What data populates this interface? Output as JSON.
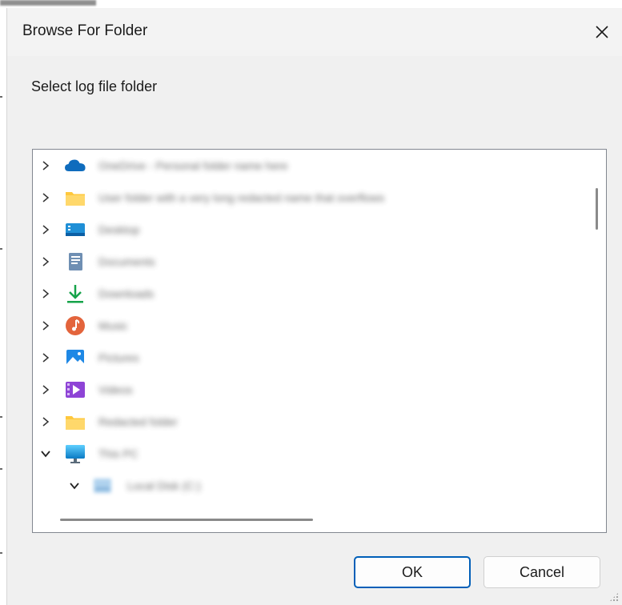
{
  "dialog": {
    "title": "Browse For Folder",
    "prompt": "Select log file folder",
    "ok_label": "OK",
    "cancel_label": "Cancel"
  },
  "tree": {
    "items": [
      {
        "icon": "onedrive-cloud-icon",
        "expanded": false,
        "label": "OneDrive - Personal folder name here"
      },
      {
        "icon": "folder-icon",
        "expanded": false,
        "label": "User folder with a very long redacted name that overflows"
      },
      {
        "icon": "desktop-icon",
        "expanded": false,
        "label": "Desktop"
      },
      {
        "icon": "documents-icon",
        "expanded": false,
        "label": "Documents"
      },
      {
        "icon": "downloads-icon",
        "expanded": false,
        "label": "Downloads"
      },
      {
        "icon": "music-icon",
        "expanded": false,
        "label": "Music"
      },
      {
        "icon": "pictures-icon",
        "expanded": false,
        "label": "Pictures"
      },
      {
        "icon": "videos-icon",
        "expanded": false,
        "label": "Videos"
      },
      {
        "icon": "folder-icon",
        "expanded": false,
        "label": "Redacted folder"
      },
      {
        "icon": "this-pc-icon",
        "expanded": true,
        "label": "This PC"
      },
      {
        "icon": "drive-icon",
        "expanded": true,
        "label": "Local Disk (C:)"
      }
    ]
  },
  "colors": {
    "accent": "#005fb8",
    "folder": "#ffc83d",
    "onedrive": "#0f6cbd",
    "downloads": "#16a34a",
    "music": "#e3643c",
    "pictures": "#1e88e5",
    "videos": "#8e44d6"
  }
}
